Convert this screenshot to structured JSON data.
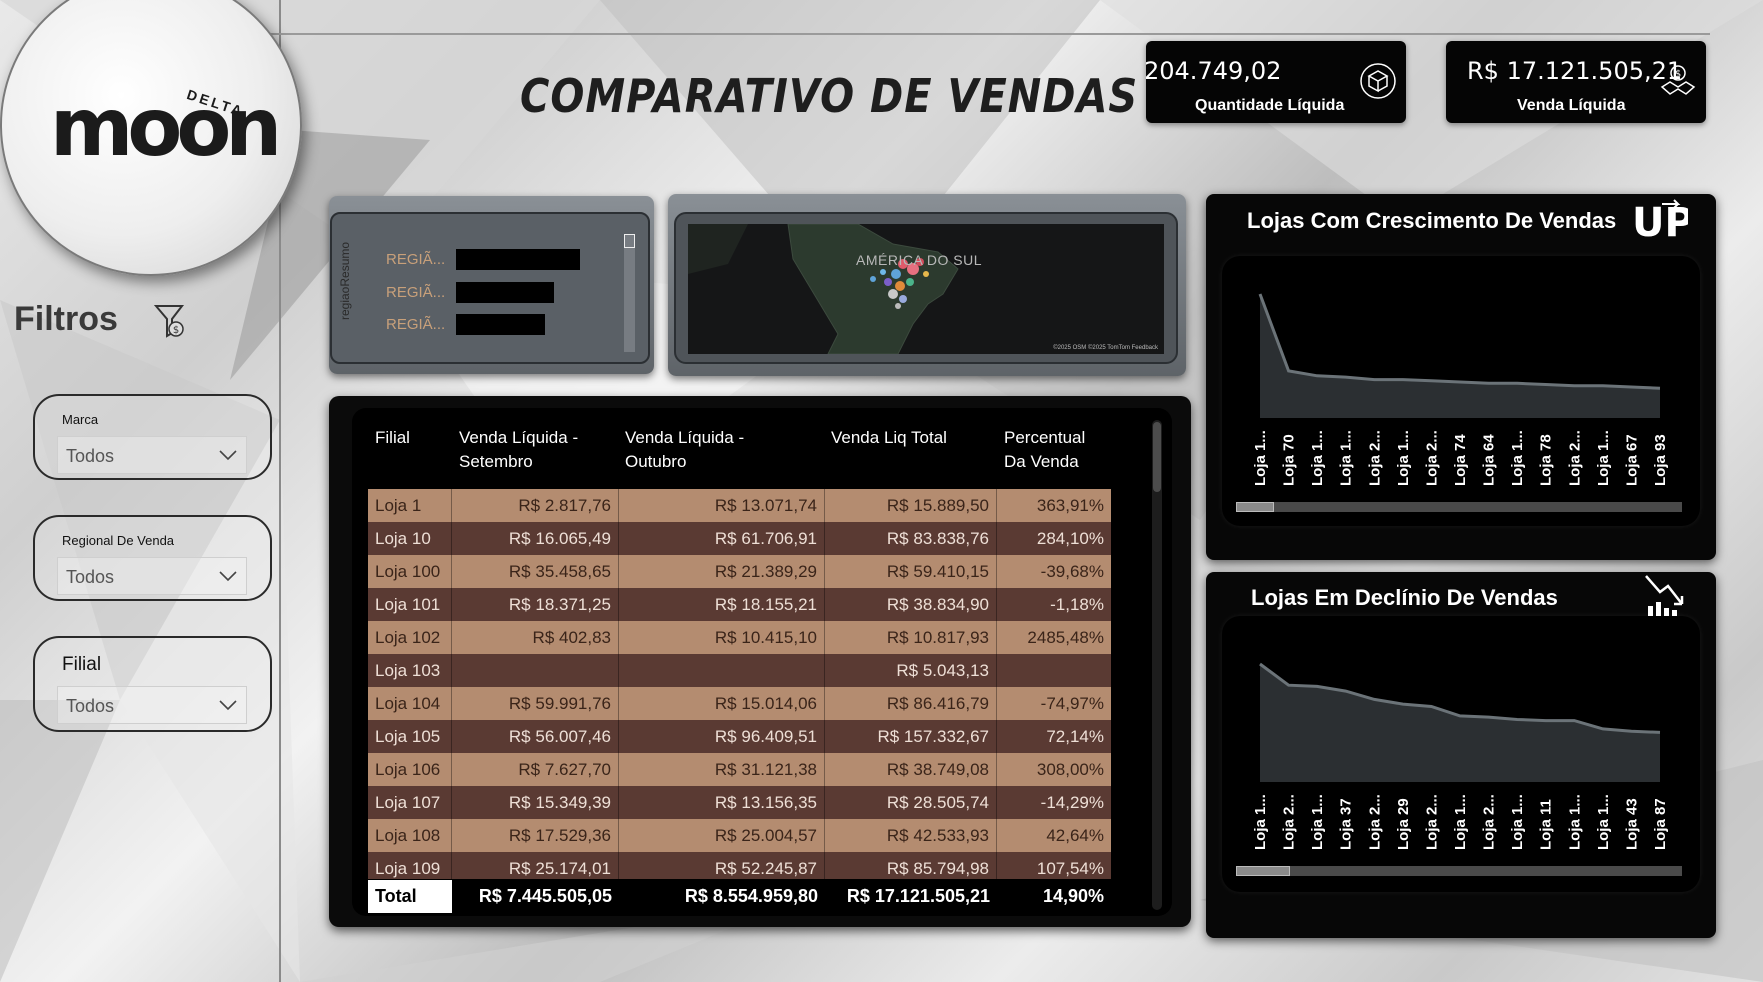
{
  "header": {
    "title": "COMPARATIVO DE VENDAS",
    "logo_text": "moon",
    "logo_sub": "DELTA"
  },
  "kpis": [
    {
      "value": "204.749,02",
      "label": "Quantidade Líquida",
      "icon": "box-exchange-icon"
    },
    {
      "value": "R$ 17.121.505,21",
      "label": "Venda Líquida",
      "icon": "handshake-icon"
    }
  ],
  "filters": {
    "title": "Filtros",
    "icon": "funnel-money-icon",
    "slicers": [
      {
        "label": "Marca",
        "value": "Todos"
      },
      {
        "label": "Regional De Venda",
        "value": "Todos"
      },
      {
        "label": "Filial",
        "value": "Todos"
      }
    ]
  },
  "region_chart": {
    "axis_label": "regiaoResumo",
    "items": [
      {
        "label": "REGIÃ...",
        "value": 1.0
      },
      {
        "label": "REGIÃ...",
        "value": 0.79
      },
      {
        "label": "REGIÃ...",
        "value": 0.72
      }
    ]
  },
  "map": {
    "label": "AMÉRICA DO SUL",
    "credit": "©2025 OSM  ©2025 TomTom  Feedback"
  },
  "table": {
    "columns": [
      "Filial",
      "Venda Líquida - Setembro",
      "Venda Líquida - Outubro",
      "Venda Liq Total",
      "Percentual Da Venda"
    ],
    "column_lines": [
      [
        "Filial"
      ],
      [
        "Venda Líquida -",
        "Setembro"
      ],
      [
        "Venda Líquida -",
        "Outubro"
      ],
      [
        "Venda Liq Total"
      ],
      [
        "Percentual",
        "Da Venda"
      ]
    ],
    "rows": [
      [
        "Loja 1",
        "R$ 2.817,76",
        "R$ 13.071,74",
        "R$ 15.889,50",
        "363,91%"
      ],
      [
        "Loja 10",
        "R$ 16.065,49",
        "R$ 61.706,91",
        "R$ 83.838,76",
        "284,10%"
      ],
      [
        "Loja 100",
        "R$ 35.458,65",
        "R$ 21.389,29",
        "R$ 59.410,15",
        "-39,68%"
      ],
      [
        "Loja 101",
        "R$ 18.371,25",
        "R$ 18.155,21",
        "R$ 38.834,90",
        "-1,18%"
      ],
      [
        "Loja 102",
        "R$ 402,83",
        "R$ 10.415,10",
        "R$ 10.817,93",
        "2485,48%"
      ],
      [
        "Loja 103",
        "",
        "",
        "R$ 5.043,13",
        ""
      ],
      [
        "Loja 104",
        "R$ 59.991,76",
        "R$ 15.014,06",
        "R$ 86.416,79",
        "-74,97%"
      ],
      [
        "Loja 105",
        "R$ 56.007,46",
        "R$ 96.409,51",
        "R$ 157.332,67",
        "72,14%"
      ],
      [
        "Loja 106",
        "R$ 7.627,70",
        "R$ 31.121,38",
        "R$ 38.749,08",
        "308,00%"
      ],
      [
        "Loja 107",
        "R$ 15.349,39",
        "R$ 13.156,35",
        "R$ 28.505,74",
        "-14,29%"
      ],
      [
        "Loja 108",
        "R$ 17.529,36",
        "R$ 25.004,57",
        "R$ 42.533,93",
        "42,64%"
      ],
      [
        "Loja 109",
        "R$ 25.174,01",
        "R$ 52.245,87",
        "R$ 85.794,98",
        "107,54%"
      ]
    ],
    "total": [
      "Total",
      "R$ 7.445.505,05",
      "R$ 8.554.959,80",
      "R$ 17.121.505,21",
      "14,90%"
    ]
  },
  "growth_chart": {
    "title": "Lojas Com Crescimento De Vendas",
    "icon": "up-icon",
    "icon_text": "UP",
    "categories": [
      "Loja 1...",
      "Loja 70",
      "Loja 1...",
      "Loja 1...",
      "Loja 2...",
      "Loja 1...",
      "Loja 2...",
      "Loja 74",
      "Loja 64",
      "Loja 1...",
      "Loja 78",
      "Loja 2...",
      "Loja 1...",
      "Loja 67",
      "Loja 93"
    ],
    "values": [
      100,
      38,
      34,
      33,
      31,
      31,
      30,
      29,
      28,
      28,
      27,
      26,
      26,
      25,
      24
    ]
  },
  "decline_chart": {
    "title": "Lojas Em Declínio De Vendas",
    "icon": "chart-down-icon",
    "categories": [
      "Loja 1...",
      "Loja 2...",
      "Loja 1...",
      "Loja 37",
      "Loja 2...",
      "Loja 29",
      "Loja 2...",
      "Loja 1...",
      "Loja 2...",
      "Loja 1...",
      "Loja 11",
      "Loja 1...",
      "Loja 1...",
      "Loja 43",
      "Loja 87"
    ],
    "values": [
      100,
      82,
      81,
      77,
      70,
      66,
      64,
      56,
      55,
      53,
      52,
      52,
      45,
      43,
      42
    ]
  }
}
